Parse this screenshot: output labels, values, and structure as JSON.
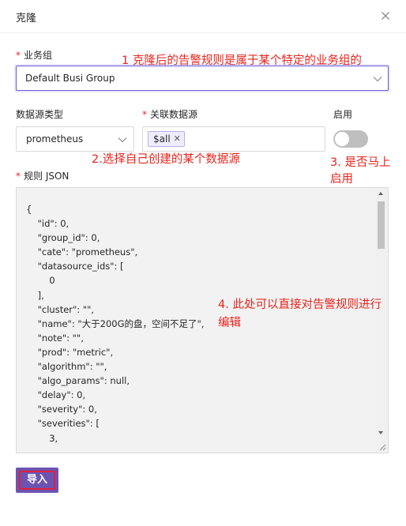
{
  "modal": {
    "title": "克隆",
    "close_icon": "close-icon",
    "import_label": "导入"
  },
  "form": {
    "business_group": {
      "label": "业务组",
      "value": "Default Busi Group"
    },
    "datasource_type": {
      "label": "数据源类型",
      "value": "prometheus"
    },
    "datasources": {
      "label": "关联数据源",
      "tags": [
        "$all"
      ]
    },
    "enabled": {
      "label": "启用",
      "value": false
    },
    "rule_json": {
      "label": "规则 JSON",
      "content": "{\n    \"id\": 0,\n    \"group_id\": 0,\n    \"cate\": \"prometheus\",\n    \"datasource_ids\": [\n        0\n    ],\n    \"cluster\": \"\",\n    \"name\": \"大于200G的盘，空间不足了\",\n    \"note\": \"\",\n    \"prod\": \"metric\",\n    \"algorithm\": \"\",\n    \"algo_params\": null,\n    \"delay\": 0,\n    \"severity\": 0,\n    \"severities\": [\n        3,"
    }
  },
  "annotations": {
    "a1": "1 克隆后的告警规则是属于某个特定的业务组的",
    "a2": "2.选择自己创建的某个数据源",
    "a3_line1": "3. 是否马上",
    "a3_line2": "启用",
    "a4_line1": "4.  此处可以直接对告警规则进行",
    "a4_line2": "编辑",
    "color": "#e8241c"
  },
  "colors": {
    "primary": "#6c53b1",
    "required": "#f5222d",
    "highlight_border": "#e0203d"
  }
}
